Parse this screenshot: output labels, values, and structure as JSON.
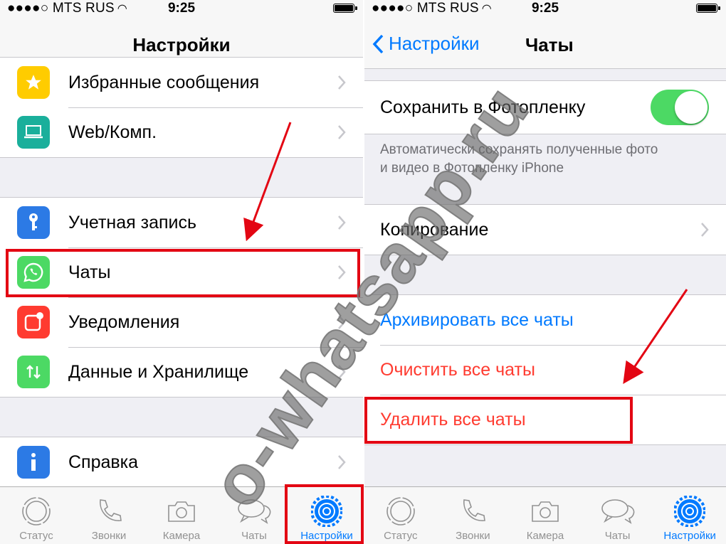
{
  "status_bar": {
    "carrier": "●●●●○ MTS RUS",
    "wifi": "◠",
    "time": "9:25"
  },
  "left": {
    "title": "Настройки",
    "items": [
      {
        "label": "Избранные сообщения",
        "icon": "star-icon",
        "color": "#ffcc00"
      },
      {
        "label": "Web/Комп.",
        "icon": "laptop-icon",
        "color": "#1aaf9b"
      },
      {
        "label": "Учетная запись",
        "icon": "key-icon",
        "color": "#2c7ae5"
      },
      {
        "label": "Чаты",
        "icon": "whatsapp-icon",
        "color": "#4cd964"
      },
      {
        "label": "Уведомления",
        "icon": "notification-icon",
        "color": "#ff3b30"
      },
      {
        "label": "Данные и Хранилище",
        "icon": "arrows-icon",
        "color": "#4cd964"
      },
      {
        "label": "Справка",
        "icon": "info-icon",
        "color": "#2c7ae5"
      }
    ]
  },
  "right": {
    "back_label": "Настройки",
    "title": "Чаты",
    "save_label": "Сохранить в Фотопленку",
    "save_enabled": true,
    "save_note_line1": "Автоматически сохранять полученные фото",
    "save_note_line2": "и видео в Фотопленку iPhone",
    "backup_label": "Копирование",
    "archive_label": "Архивировать все чаты",
    "clear_label": "Очистить все чаты",
    "delete_label": "Удалить все чаты"
  },
  "tabs": [
    "Статус",
    "Звонки",
    "Камера",
    "Чаты",
    "Настройки"
  ],
  "active_tab": "Настройки",
  "watermark": "o-whatsapp.ru",
  "colors": {
    "accent": "#007aff",
    "destructive": "#ff3b30",
    "highlight": "#e30613",
    "toggle_on": "#4cd964"
  }
}
